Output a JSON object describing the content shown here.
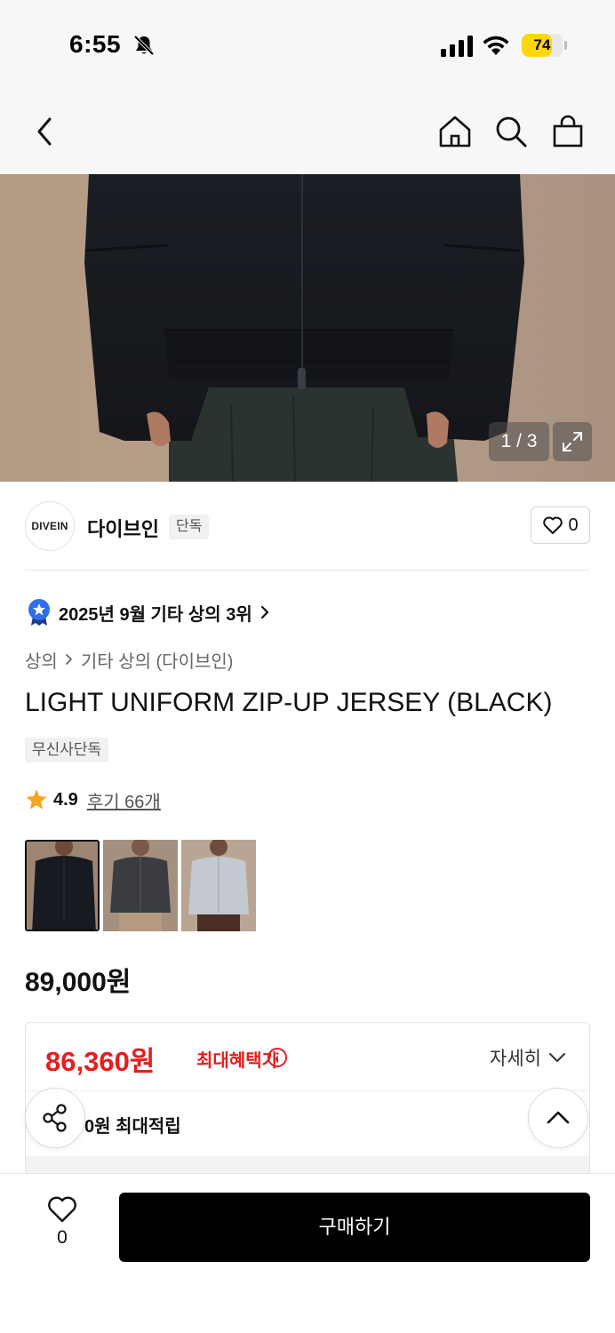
{
  "status_bar": {
    "time": "6:55",
    "battery": "74",
    "battery_level": 0.74,
    "icons": [
      "bell-slash-icon",
      "signal-icon",
      "wifi-icon",
      "battery-charging-icon"
    ]
  },
  "navbar": {
    "icons": [
      "back-chevron-icon",
      "home-icon",
      "search-icon",
      "shopping-bag-icon"
    ]
  },
  "gallery": {
    "counter": "1 / 3",
    "current": 1,
    "total": 3,
    "icons": [
      "expand-icon"
    ]
  },
  "brand": {
    "logo_text": "DIVEIN",
    "name": "다이브인",
    "badge": "단독",
    "like_count": "0"
  },
  "ranking": {
    "text": "2025년 9월 기타 상의 3위",
    "icon": "ranking-medal-icon"
  },
  "breadcrumb": {
    "level1": "상의",
    "level2": "기타 상의 (다이브인)"
  },
  "product": {
    "title": "LIGHT UNIFORM ZIP-UP JERSEY (BLACK)",
    "exclusive_tag": "무신사단독",
    "rating": "4.9",
    "reviews": "후기 66개",
    "price": "89,000원"
  },
  "thumbnails": [
    {
      "color_name": "black",
      "selected": true
    },
    {
      "color_name": "charcoal",
      "selected": false
    },
    {
      "color_name": "light-gray",
      "selected": false
    }
  ],
  "benefit": {
    "max_price": "86,360원",
    "max_label": "최대혜택가",
    "details_label": "자세히",
    "points": "0원 최대적립"
  },
  "bottom_bar": {
    "wish_count": "0",
    "buy_label": "구매하기"
  },
  "colors": {
    "accent_red": "#e41e1e",
    "star": "#f5a623",
    "badge_blue": "#2f6fed",
    "battery_yellow": "#ffd60a",
    "buy_button": "#000000"
  }
}
